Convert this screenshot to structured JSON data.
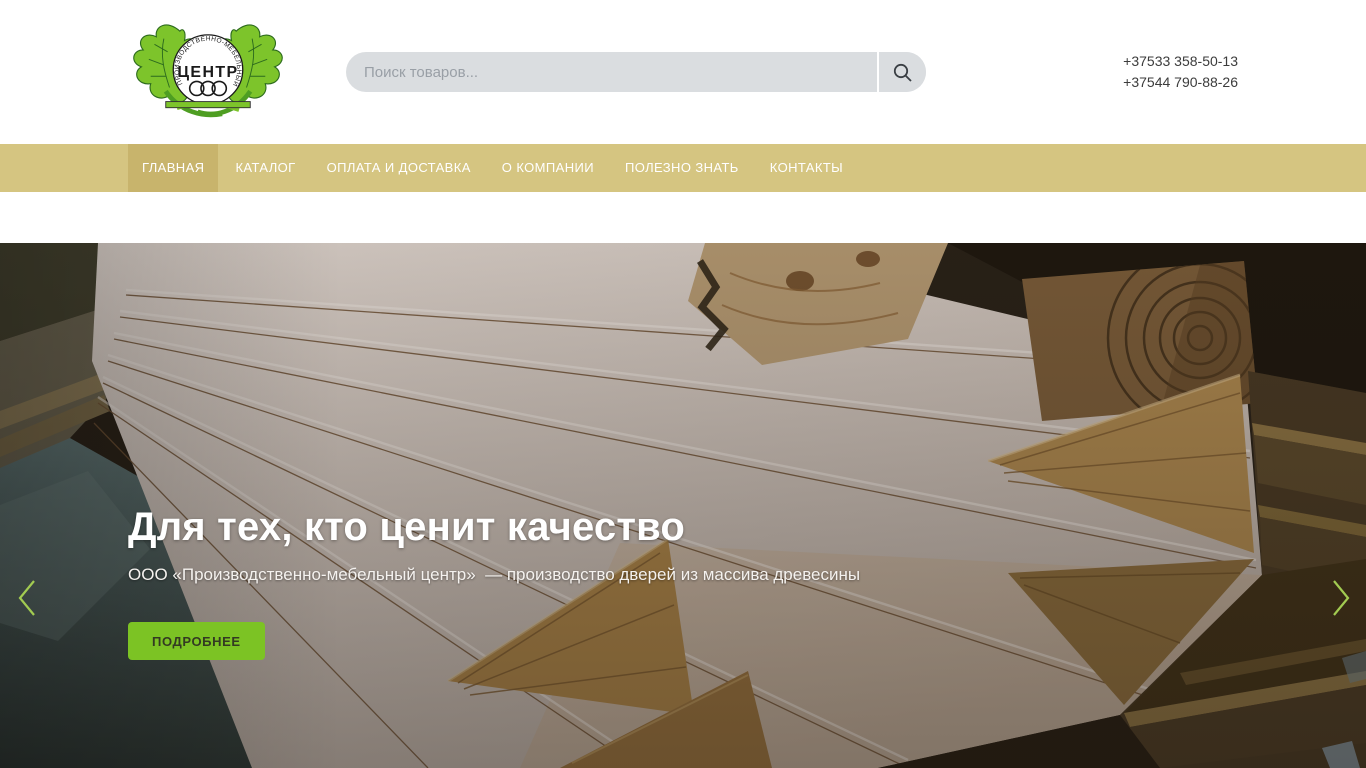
{
  "header": {
    "logo": {
      "ring_text": "ПРОИЗВОДСТВЕННО-МЕБЕЛЬНЫЙ",
      "center_text": "ЦЕНТР"
    },
    "search": {
      "placeholder": "Поиск товаров...",
      "icon": "magnifier"
    },
    "phones": [
      "+37533 358-50-13",
      "+37544 790-88-26"
    ]
  },
  "nav": {
    "items": [
      {
        "label": "ГЛАВНАЯ",
        "active": true
      },
      {
        "label": "КАТАЛОГ",
        "active": false
      },
      {
        "label": "ОПЛАТА И ДОСТАВКА",
        "active": false
      },
      {
        "label": "О КОМПАНИИ",
        "active": false
      },
      {
        "label": "ПОЛЕЗНО ЗНАТЬ",
        "active": false
      },
      {
        "label": "КОНТАКТЫ",
        "active": false
      }
    ]
  },
  "hero": {
    "title": "Для тех, кто ценит качество",
    "subtitle": "ООО «Производственно-мебельный центр»  — производство дверей из массива древесины",
    "cta_label": "ПОДРОБНЕЕ"
  },
  "colors": {
    "accent_green": "#7cc324",
    "logo_green": "#7dc42b",
    "nav_bg": "#d5c581",
    "nav_active_bg": "#c8b46c",
    "search_bg": "#dadde0",
    "arrow_green": "#a2cb51"
  }
}
